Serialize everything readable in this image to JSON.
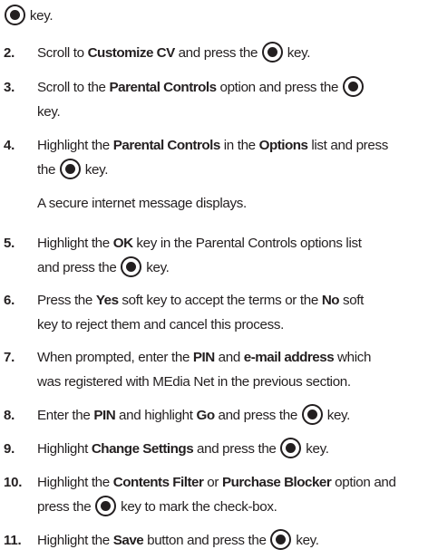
{
  "top_line": {
    "key_word": "key."
  },
  "steps": [
    {
      "num": "2.",
      "segments": [
        {
          "t": "Scroll to "
        },
        {
          "b": "Customize CV"
        },
        {
          "t": " and press the "
        },
        {
          "icon": "center-key-icon"
        },
        {
          "t": " key."
        }
      ]
    },
    {
      "num": "3.",
      "segments": [
        {
          "t": "Scroll to the "
        },
        {
          "b": "Parental Controls"
        },
        {
          "t": " option and press the "
        },
        {
          "icon": "center-key-icon"
        },
        {
          "br": true
        },
        {
          "t": "key."
        }
      ]
    },
    {
      "num": "4.",
      "segments": [
        {
          "t": "Highlight the "
        },
        {
          "b": "Parental Controls"
        },
        {
          "t": " in the "
        },
        {
          "b": "Options"
        },
        {
          "t": " list and press"
        },
        {
          "br": true
        },
        {
          "t": "the "
        },
        {
          "icon": "center-key-icon"
        },
        {
          "t": " key."
        }
      ],
      "note": "A secure internet message displays."
    },
    {
      "num": "5.",
      "segments": [
        {
          "t": "Highlight the "
        },
        {
          "b": "OK"
        },
        {
          "t": " key in the Parental Controls options list"
        },
        {
          "br": true
        },
        {
          "t": "and press the "
        },
        {
          "icon": "center-key-icon"
        },
        {
          "t": " key."
        }
      ]
    },
    {
      "num": "6.",
      "segments": [
        {
          "t": "Press the "
        },
        {
          "b": "Yes"
        },
        {
          "t": " soft key to accept the terms or the "
        },
        {
          "b": "No"
        },
        {
          "t": " soft"
        },
        {
          "br": true
        },
        {
          "t": "key to reject them and cancel this process."
        }
      ]
    },
    {
      "num": "7.",
      "segments": [
        {
          "t": "When prompted, enter the "
        },
        {
          "b": "PIN"
        },
        {
          "t": " and "
        },
        {
          "b": "e-mail address"
        },
        {
          "t": " which"
        },
        {
          "br": true
        },
        {
          "t": "was registered with MEdia Net in the previous section."
        }
      ]
    },
    {
      "num": "8.",
      "segments": [
        {
          "t": "Enter the "
        },
        {
          "b": "PIN"
        },
        {
          "t": " and highlight "
        },
        {
          "b": "Go"
        },
        {
          "t": " and press the "
        },
        {
          "icon": "center-key-icon"
        },
        {
          "t": " key."
        }
      ]
    },
    {
      "num": "9.",
      "segments": [
        {
          "t": "Highlight "
        },
        {
          "b": "Change Settings"
        },
        {
          "t": " and press the "
        },
        {
          "icon": "center-key-icon"
        },
        {
          "t": " key."
        }
      ]
    },
    {
      "num": "10.",
      "segments": [
        {
          "t": "Highlight the "
        },
        {
          "b": "Contents Filter"
        },
        {
          "t": " or "
        },
        {
          "b": "Purchase Blocker"
        },
        {
          "t": " option and"
        },
        {
          "br": true
        },
        {
          "t": "press the "
        },
        {
          "icon": "center-key-icon"
        },
        {
          "t": " key to mark the check-box."
        }
      ]
    },
    {
      "num": "11.",
      "segments": [
        {
          "t": "Highlight the "
        },
        {
          "b": "Save"
        },
        {
          "t": " button and press the "
        },
        {
          "icon": "center-key-icon"
        },
        {
          "t": " key."
        }
      ]
    }
  ]
}
